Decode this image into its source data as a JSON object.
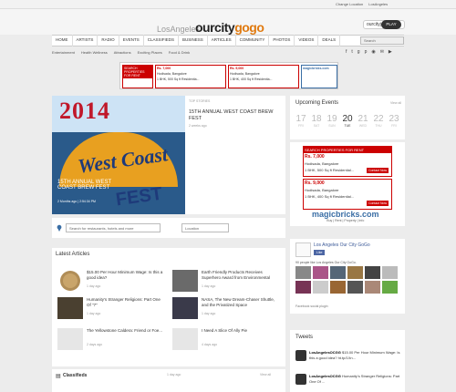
{
  "topbar": {
    "change_location": "Change Location",
    "city": "LosAngeles"
  },
  "header": {
    "city": "LosAngeles",
    "logo_a": "ourcity",
    "logo_b": "gogo",
    "joy_label": "ourcityjoy",
    "play_label": "PLAY"
  },
  "nav": {
    "items": [
      "HOME",
      "ARTISTS",
      "RADIO",
      "EVENTS",
      "CLASSIFIEDS",
      "BUSINESS",
      "ARTICLES",
      "COMMUNITY",
      "PHOTOS",
      "VIDEOS",
      "DEALS"
    ],
    "search_placeholder": "Search"
  },
  "subnav": [
    "Entertainment",
    "Health Wellness",
    "Attractions",
    "Exciting Places",
    "Food & Drink"
  ],
  "social_icons": [
    "facebook-icon",
    "twitter-icon",
    "google-plus-icon",
    "pinterest-icon",
    "rss-icon",
    "email-icon",
    "youtube-icon"
  ],
  "top_ad": {
    "blocks": [
      {
        "label": "SEARCH PROPERTIES FOR RENT",
        "price": "Rs. 7,000",
        "place": "Hodisada, Bangalore",
        "desc": "1 BHK, 500 Sq ft Residentia..."
      },
      {
        "label": "",
        "price": "Rs. 9,000",
        "place": "Hodisada, Bangalore",
        "desc": "1 BHK, 400 Sq ft Residentia..."
      },
      {
        "label": "",
        "price": "magicbricks.com",
        "place": "",
        "desc": ""
      }
    ],
    "contact": "Contact Now"
  },
  "hero": {
    "year": "2014",
    "word_west": "West Coast",
    "word_fest": "FEST",
    "caption": "15TH ANNUAL WEST COAST BREW FEST",
    "meta": "2 Months ago  |  2:54:34 PM"
  },
  "top_stories": {
    "label": "TOP STORIES",
    "title": "15TH ANNUAL WEST COAST BREW FEST",
    "time": "2 weeks ago"
  },
  "search": {
    "placeholder": "Search for restaurants, hotels and more",
    "location": "Location"
  },
  "latest": {
    "title": "Latest Articles",
    "articles": [
      {
        "title": "$15.00 Per Hour Minimum Wage: Is this a good idea?",
        "date": "1 day ago"
      },
      {
        "title": "Earth Friendly Products Receives Superhero Award from Environmental",
        "date": "1 day ago"
      },
      {
        "title": "Humanity's Stranger Religions: Part One Of \"7\"",
        "date": "1 day ago"
      },
      {
        "title": "NASA, The New Dream-Chaser Shuttle, and the Privatized Space",
        "date": "1 day ago"
      },
      {
        "title": "The Yellowstone Caldera: Friend or Foe...",
        "date": "2 days ago"
      },
      {
        "title": "I Need A Slice Of Ally Pie",
        "date": "4 days ago"
      }
    ]
  },
  "classifieds": {
    "title": "Classifieds",
    "view_all": "View all",
    "date": "1 day ago"
  },
  "upcoming": {
    "title": "Upcoming Events",
    "view_all": "View all",
    "days": [
      {
        "n": "17",
        "w": "FRI"
      },
      {
        "n": "18",
        "w": "SAT"
      },
      {
        "n": "19",
        "w": "SUN"
      },
      {
        "n": "20",
        "w": "TUE"
      },
      {
        "n": "21",
        "w": "WED"
      },
      {
        "n": "22",
        "w": "THU"
      },
      {
        "n": "23",
        "w": "FRI"
      }
    ]
  },
  "side_ad": {
    "label": "SEARCH PROPERTIES FOR RENT",
    "blocks": [
      {
        "price": "Rs. 7,000",
        "place": "Hodisada, Bangalore",
        "desc": "1 BHK, 500 Sq ft Residential..."
      },
      {
        "price": "Rs. 9,000",
        "place": "Hodisada, Bangalore",
        "desc": "1 BHK, 400 Sq ft Residential..."
      }
    ],
    "contact": "Contact Now",
    "brand": "magicbricks.com",
    "brand_sub": "Buy | Rent | Property | Info"
  },
  "facebook": {
    "page": "Los Angeles Our City GoGo",
    "like": "Like",
    "likes": "90 people like Los Angeles Our City GoGo.",
    "plugin": "Facebook social plugin"
  },
  "tweets": {
    "title": "Tweets",
    "items": [
      {
        "handle": "LosAngelesOCGG",
        "text": "$15.00 Per Hour Minimum Wage: Is this a good idea? ht.tp/1Xn..."
      },
      {
        "handle": "LosAngelesOCGG",
        "text": "Humanity's Stranger Religions: Part One Of ..."
      }
    ]
  }
}
